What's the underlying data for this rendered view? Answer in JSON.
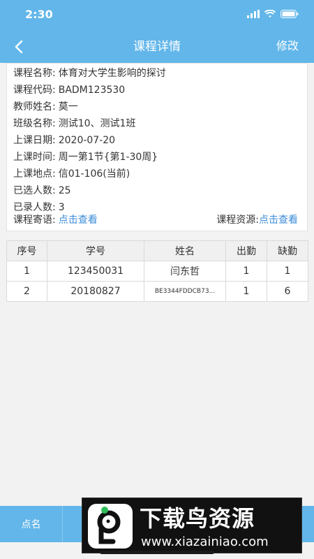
{
  "status": {
    "time": "2:30"
  },
  "header": {
    "title": "课程详情",
    "edit_label": "修改"
  },
  "course": {
    "rows": [
      {
        "label": "课程名称:",
        "value": "体育对大学生影响的探讨"
      },
      {
        "label": "课程代码:",
        "value": " BADM123530"
      },
      {
        "label": "教师姓名:",
        "value": "莫一"
      },
      {
        "label": "班级名称:",
        "value": "测试10、测试1班"
      },
      {
        "label": "上课日期:",
        "value": "2020-07-20"
      },
      {
        "label": "上课时间:",
        "value": "周一第1节{第1-30周}"
      },
      {
        "label": "上课地点:",
        "value": "信01-106(当前)"
      },
      {
        "label": "已选人数:",
        "value": "25"
      },
      {
        "label": "已录人数:",
        "value": "3"
      }
    ],
    "message_label": "课程寄语:",
    "message_link": "点击查看",
    "resource_label": "课程资源:",
    "resource_link": "点击查看"
  },
  "table": {
    "headers": [
      "序号",
      "学号",
      "姓名",
      "出勤",
      "缺勤"
    ],
    "rows": [
      [
        "1",
        "123450031",
        "闫东哲",
        "1",
        "1"
      ],
      [
        "2",
        "20180827",
        "BE3344FDDCB73...",
        "1",
        "6"
      ]
    ]
  },
  "bottom": {
    "tab_label": "点名"
  },
  "watermark": {
    "title": "下载鸟资源",
    "url": "www.xiazainiao.com"
  },
  "colors": {
    "primary": "#62b6ea",
    "link": "#3a8bd8"
  }
}
